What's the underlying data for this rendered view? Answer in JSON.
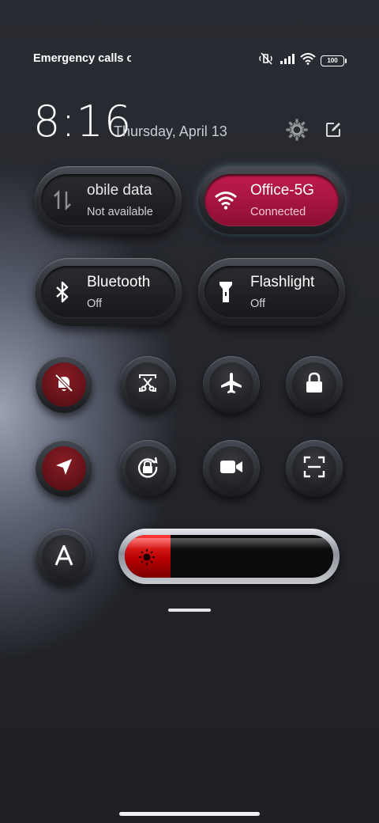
{
  "status_bar": {
    "carrier_text": "Emergency calls o",
    "battery_level": "100",
    "icons": [
      "mute-vibrate-icon",
      "signal-icon",
      "wifi-icon",
      "battery-icon"
    ]
  },
  "header": {
    "time": "8:16",
    "date": "Thursday, April 13",
    "icons": [
      "settings-icon",
      "edit-icon"
    ]
  },
  "tiles": {
    "mobile_data": {
      "title": "Mobile data",
      "visible_title": "obile data",
      "status": "Not available",
      "icon": "data-transfer-icon"
    },
    "wifi": {
      "title": "Office-5G",
      "status": "Connected",
      "icon": "wifi-icon",
      "accent": "#c01b4d"
    },
    "bluetooth": {
      "title": "Bluetooth",
      "status": "Off",
      "icon": "bluetooth-icon"
    },
    "flashlight": {
      "title": "Flashlight",
      "status": "Off",
      "icon": "flashlight-icon"
    }
  },
  "toggles": [
    {
      "name": "mute",
      "icon": "bell-off-icon",
      "active": true
    },
    {
      "name": "screenshot",
      "icon": "scissors-icon",
      "active": false
    },
    {
      "name": "airplane-mode",
      "icon": "airplane-icon",
      "active": false
    },
    {
      "name": "lock-screen",
      "icon": "lock-icon",
      "active": false
    },
    {
      "name": "location",
      "icon": "location-arrow-icon",
      "active": true
    },
    {
      "name": "rotation-lock",
      "icon": "rotation-lock-icon",
      "active": false
    },
    {
      "name": "screen-recorder",
      "icon": "video-camera-icon",
      "active": false
    },
    {
      "name": "scanner",
      "icon": "scan-icon",
      "active": false
    },
    {
      "name": "auto-brightness",
      "icon": "letter-a-icon",
      "active": false
    }
  ],
  "brightness": {
    "level": 0.22,
    "icon": "sun-icon",
    "accent": "#e01010"
  }
}
